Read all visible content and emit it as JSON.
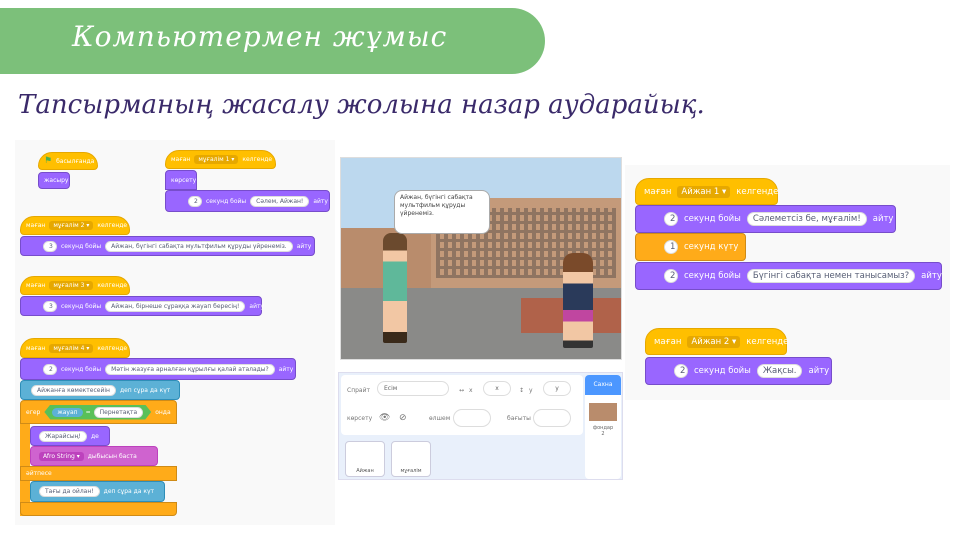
{
  "header": {
    "title": "Компьютермен жұмыс",
    "subtitle": "Тапсырманың жасалу жолына назар аударайық."
  },
  "left_scripts": {
    "s1": {
      "hat": "басылғанда",
      "hide": "жасыру"
    },
    "s2": {
      "when": "маған",
      "msg": "мұғалім 1",
      "received": "келгенде",
      "show": "көрсету",
      "secs": "2",
      "for_secs": "секунд бойы",
      "text": "Сәлем, Айжан!",
      "say": "айту"
    },
    "s3": {
      "when": "маған",
      "msg": "мұғалім 2",
      "received": "келгенде",
      "secs": "3",
      "for_secs": "секунд бойы",
      "text": "Айжан, бүгінгі сабақта мультфильм құруды үйренеміз.",
      "say": "айту"
    },
    "s4": {
      "when": "маған",
      "msg": "мұғалім 3",
      "received": "келгенде",
      "secs": "3",
      "for_secs": "секунд бойы",
      "text": "Айжан, бірнеше сұраққа жауап бересің!",
      "say": "айту"
    },
    "s5": {
      "when": "маған",
      "msg": "мұғалім 4",
      "received": "келгенде",
      "secs": "2",
      "for_secs": "секунд бойы",
      "text": "Мәтін жазуға арналған құрылғы қалай аталады?",
      "say": "айту",
      "ask1": "Айжанға көмектесейін",
      "ask_wait": "деп сұра да күт",
      "if": "егер",
      "answer": "жауап",
      "eq": "=",
      "value": "Пернетақта",
      "then": "онда",
      "think": "Жарайсың!",
      "think_say": "де",
      "sound": "Afro String",
      "sound_play": "дыбысын баста",
      "else": "әйтпесе",
      "ask2": "Тағы да ойлан!",
      "ask2_wait": "деп сұра да күт"
    }
  },
  "stage": {
    "bubble": "Айжан, бүгінгі сабақта мультфильм құруды үйренеміз."
  },
  "sprite_pane": {
    "sprite_label": "Спрайт",
    "sprite_name": "Есім",
    "x_label": "x",
    "x_value": "x",
    "y_label": "y",
    "y_value": "y",
    "show_label": "көрсету",
    "size_label": "өлшем",
    "direction_label": "бағыты",
    "sprites": [
      "Айжан",
      "мұғалім"
    ],
    "stage_label": "Сахна",
    "backdrops_label": "фондар",
    "backdrops_count": "2"
  },
  "right_scripts": {
    "r1": {
      "when": "маған",
      "msg": "Айжан 1",
      "received": "келгенде",
      "secs1": "2",
      "for_secs": "секунд бойы",
      "text1": "Сәлеметсіз бе, мұғалім!",
      "say": "айту",
      "wait_secs": "1",
      "wait": "секунд күту",
      "secs2": "2",
      "text2": "Бүгінгі сабақта немен танысамыз?"
    },
    "r2": {
      "when": "маған",
      "msg": "Айжан 2",
      "received": "келгенде",
      "secs": "2",
      "for_secs": "секунд бойы",
      "text": "Жақсы.",
      "say": "айту"
    }
  },
  "colors": {
    "banner": "#7cc07a",
    "events": "#ffbf00",
    "looks": "#9966ff",
    "sensing": "#5cb1d6",
    "control": "#ffab19",
    "sound": "#cf63cf",
    "operators": "#59c059"
  }
}
